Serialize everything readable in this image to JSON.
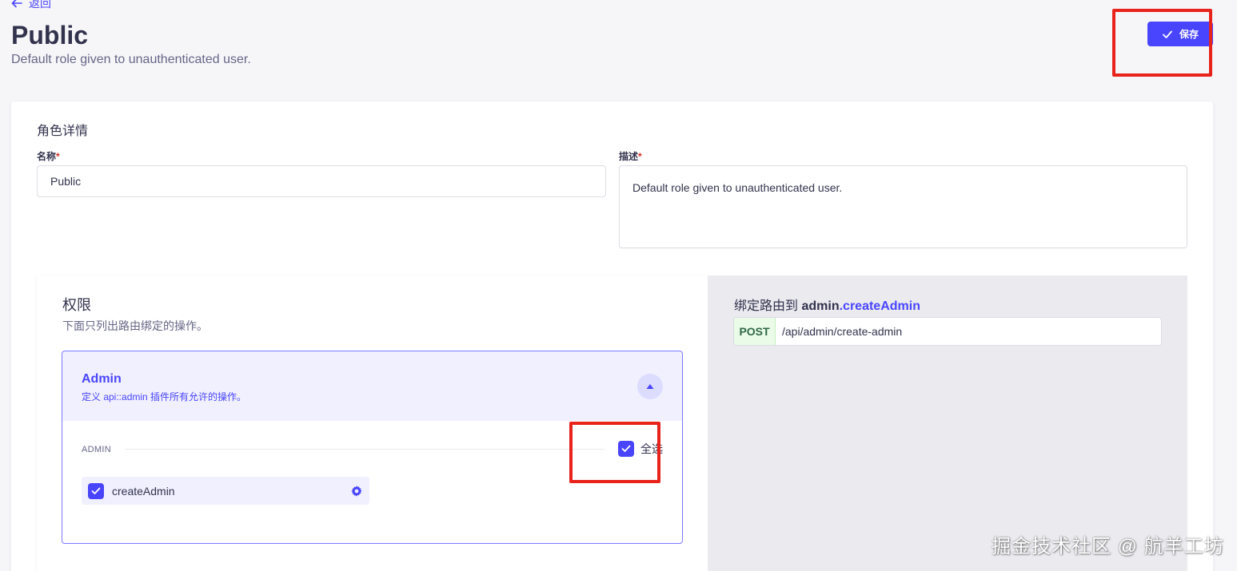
{
  "header": {
    "back_label": "返回",
    "title": "Public",
    "subtitle": "Default role given to unauthenticated user.",
    "save_label": "保存"
  },
  "details": {
    "section_title": "角色详情",
    "name_label": "名称",
    "name_value": "Public",
    "desc_label": "描述",
    "desc_value": "Default role given to unauthenticated user.",
    "required_mark": "*"
  },
  "permissions": {
    "title": "权限",
    "description": "下面只列出路由绑定的操作。",
    "plugin": {
      "name": "Admin",
      "description": "定义 api::admin 插件所有允许的操作。",
      "group_label": "ADMIN",
      "select_all_label": "全选",
      "select_all_checked": true,
      "actions": [
        {
          "label": "createAdmin",
          "checked": true
        }
      ]
    },
    "next_section_peek": "(部分可见)"
  },
  "route": {
    "title_prefix": "绑定路由到",
    "controller": "admin",
    "separator": ".",
    "action": "createAdmin",
    "method": "POST",
    "path": "/api/admin/create-admin"
  },
  "watermark": "掘金技术社区 @ 航羊工坊",
  "colors": {
    "accent": "#4945ff",
    "highlight": "#e8231b",
    "post_badge_bg": "#eafbe7",
    "post_badge_text": "#2f6846"
  },
  "icons": {
    "back": "arrow-left-icon",
    "save": "check-icon",
    "collapse": "chevron-up-icon",
    "action_settings": "gear-icon"
  }
}
